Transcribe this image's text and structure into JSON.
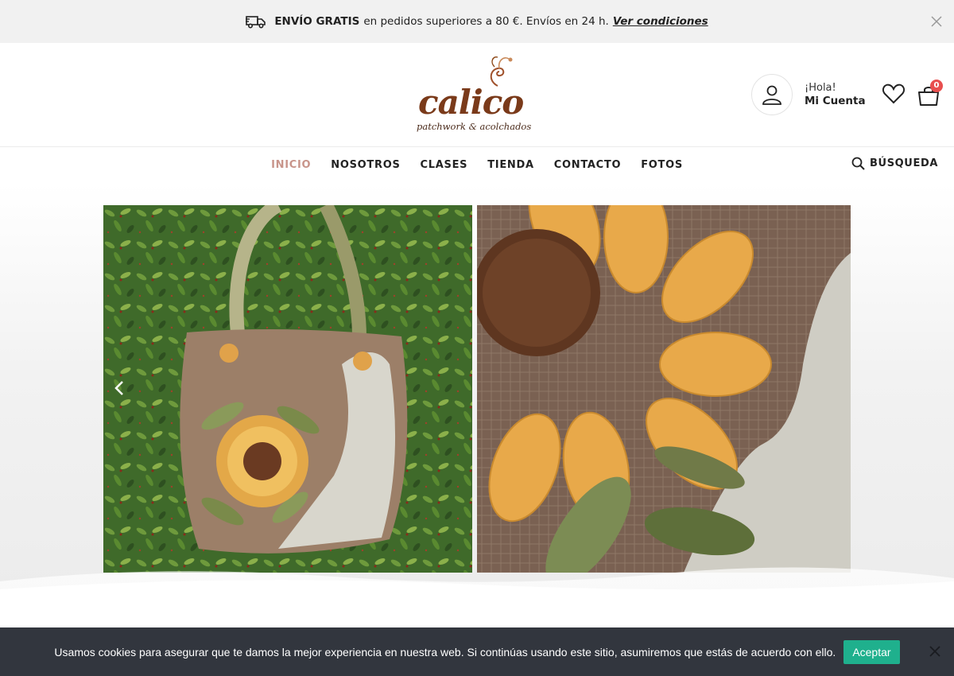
{
  "topbar": {
    "bold": "ENVÍO GRATIS",
    "text": "en pedidos superiores a 80 €. Envíos en 24 h.",
    "link": "Ver condiciones",
    "icon": "truck-icon",
    "close_icon": "close-icon"
  },
  "brand": {
    "name": "calico",
    "tagline": "patchwork & acolchados"
  },
  "account": {
    "greeting": "¡Hola!",
    "label": "Mi Cuenta"
  },
  "cart": {
    "count": "0"
  },
  "nav": {
    "items": [
      "INICIO",
      "NOSOTROS",
      "CLASES",
      "TIENDA",
      "CONTACTO",
      "FOTOS"
    ],
    "active": "INICIO",
    "search_label": "BÚSQUEDA"
  },
  "cookie": {
    "message": "Usamos cookies para asegurar que te damos la mejor experiencia en nuestra web. Si continúas usando este sitio, asumiremos que estás de acuerdo con ello.",
    "accept": "Aceptar"
  },
  "colors": {
    "accent_nav": "#c8948a",
    "cookie_bg": "#32363e",
    "cookie_btn": "#1fb08d",
    "badge": "#e84f4f"
  }
}
